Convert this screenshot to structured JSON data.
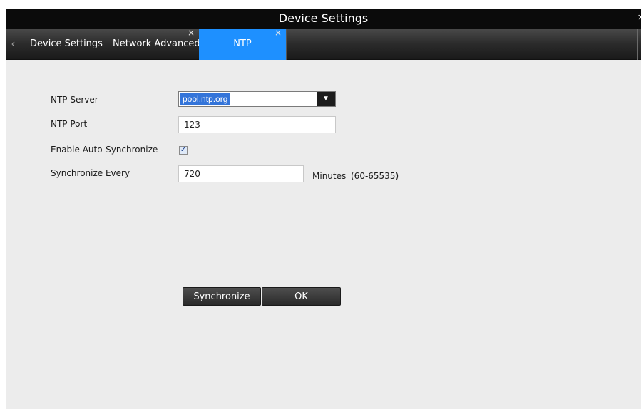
{
  "window": {
    "title": "Device Settings",
    "close_glyph": "×"
  },
  "tabs": {
    "scroll_left_glyph": "‹",
    "close_glyph": "×",
    "items": [
      {
        "label": "Device Settings",
        "closable": false,
        "active": false
      },
      {
        "label": "Network Advanced",
        "closable": true,
        "active": false
      },
      {
        "label": "NTP",
        "closable": true,
        "active": true
      }
    ]
  },
  "form": {
    "ntp_server": {
      "label": "NTP Server",
      "value": "pool.ntp.org",
      "arrow_glyph": "▼"
    },
    "ntp_port": {
      "label": "NTP Port",
      "value": "123"
    },
    "auto_sync": {
      "label": "Enable Auto-Synchronize",
      "checked": true,
      "check_glyph": "✓"
    },
    "sync_every": {
      "label": "Synchronize Every",
      "value": "720",
      "unit": "Minutes",
      "range": "(60-65535)"
    }
  },
  "buttons": {
    "synchronize": "Synchronize",
    "ok": "OK"
  },
  "colors": {
    "active_tab": "#1e90ff",
    "selection": "#3374d9",
    "titlebar": "#0b0b0b",
    "background": "#ececec"
  }
}
